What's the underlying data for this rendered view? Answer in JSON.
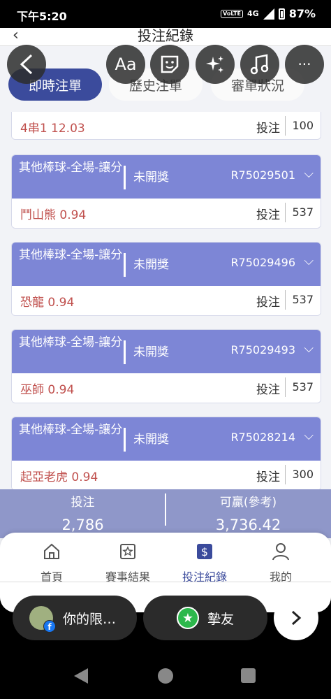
{
  "statusbar": {
    "time": "下午5:20",
    "volte": "VoLTE",
    "network": "4G",
    "battery": "87%"
  },
  "header": {
    "back": "‹",
    "title": "投注紀錄"
  },
  "tabs": [
    {
      "label": "即時注單",
      "active": true
    },
    {
      "label": "歷史注單",
      "active": false
    },
    {
      "label": "審單狀況",
      "active": false
    }
  ],
  "partial_card": {
    "pick": "4串1  12.03",
    "bet_label": "投注",
    "amount": "100"
  },
  "cards": [
    {
      "name": "其他棒球-全場-讓分",
      "status": "未開獎",
      "order": "R75029501",
      "pick": "鬥山熊   0.94",
      "bet_label": "投注",
      "amount": "537"
    },
    {
      "name": "其他棒球-全場-讓分",
      "status": "未開獎",
      "order": "R75029496",
      "pick": "恐龍   0.94",
      "bet_label": "投注",
      "amount": "537"
    },
    {
      "name": "其他棒球-全場-讓分",
      "status": "未開獎",
      "order": "R75029493",
      "pick": "巫師   0.94",
      "bet_label": "投注",
      "amount": "537"
    },
    {
      "name": "其他棒球-全場-讓分",
      "status": "未開獎",
      "order": "R75028214",
      "pick": "起亞老虎   0.94",
      "bet_label": "投注",
      "amount": "300"
    }
  ],
  "summary": {
    "bet_label": "投注",
    "bet_value": "2,786",
    "win_label": "可贏(參考)",
    "win_value": "3,736.42"
  },
  "bottom_nav": [
    {
      "label": "首頁",
      "icon": "home-icon",
      "active": false
    },
    {
      "label": "賽事結果",
      "icon": "results-icon",
      "active": false
    },
    {
      "label": "投注紀錄",
      "icon": "bet-record-icon",
      "active": true
    },
    {
      "label": "我的",
      "icon": "profile-icon",
      "active": false
    }
  ],
  "overlay": {
    "aa": "Aa",
    "more": "···"
  },
  "share_pills": [
    {
      "label": "你的限…",
      "icon": "facebook-story-icon"
    },
    {
      "label": "摯友",
      "icon": "close-friends-star-icon"
    }
  ],
  "colors": {
    "accent": "#3b4b9c",
    "card_header": "#7d86d6",
    "pick_text": "#c0504d",
    "summary_bg": "#8f97c9"
  }
}
